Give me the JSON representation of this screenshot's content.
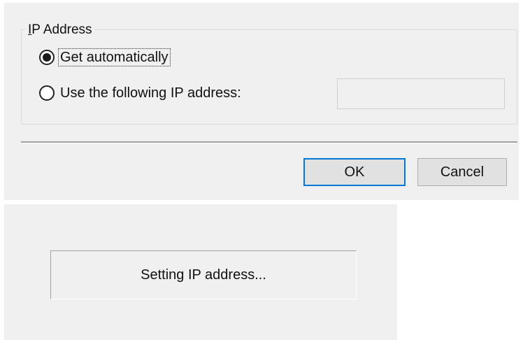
{
  "ip_dialog": {
    "group_title_mnemonic": "I",
    "group_title_rest": "P Address",
    "option_auto": {
      "label": "Get automatically",
      "selected": true
    },
    "option_manual": {
      "label": "Use the following IP address:",
      "selected": false
    },
    "ip_field": {
      "value": "",
      "enabled": false
    },
    "ok_label": "OK",
    "cancel_label": "Cancel"
  },
  "progress_dialog": {
    "status_text": "Setting IP address..."
  },
  "colors": {
    "dialog_bg": "#f0f0f0",
    "focus_border": "#0078d7",
    "button_bg": "#e1e1e1"
  }
}
